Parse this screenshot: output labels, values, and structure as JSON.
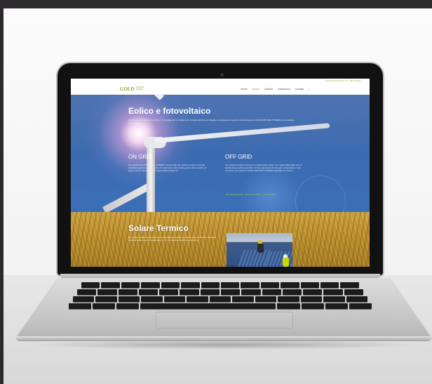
{
  "site": {
    "topbar_text": "GOLD Natural Power srl · Web Design",
    "logo": "GOLD",
    "logo_sub": "NATURAL POWER",
    "nav": [
      "Home",
      "Attività",
      "Diverse",
      "Assistenza",
      "Contatti",
      "⌕"
    ],
    "hero": {
      "title": "Eolico e fotovoltaico",
      "text": "Energia da fonti alternative pulita e rinnovabile che si trasforma in energia elettrica, tecnologia e competenza al servizio del territorio con GOLD NATURAL POWER per lo sviluppo sostenibile.",
      "on_grid": {
        "title": "ON GRID",
        "text": "Gli impianti GOLD NATURAL POWER connessi alla rete elettrica cedono l'energia prodotta al gestore e consentono di risparmiare sulla bolletta grazie allo scambio sul posto, con un monitoraggio costante della produzione."
      },
      "off_grid": {
        "title": "OFF GRID",
        "text": "Gli impianti ad isola consentono di alimentare utenze non raggiungibili dalla rete di distribuzione elettrica pubblica. Grazie agli accumuli l'energia è disponibile in ogni momento, con soluzioni GOLD NATURAL POWER progettate su misura.",
        "link": "PROGETTAZIONE · INSTALLAZIONE · ASSISTENZA"
      }
    },
    "solar": {
      "title": "Solare Termico",
      "text": "Gli impianti solari termici trasformano la radiazione solare in calore per la produzione di acqua calda sanitaria e per il riscaldamento, con un notevole risparmio energetico."
    }
  },
  "colors": {
    "accent": "#8bb52a",
    "hero_blue": "#3d6bb0",
    "wheat": "#b58a2c",
    "background": "#2b292b"
  }
}
